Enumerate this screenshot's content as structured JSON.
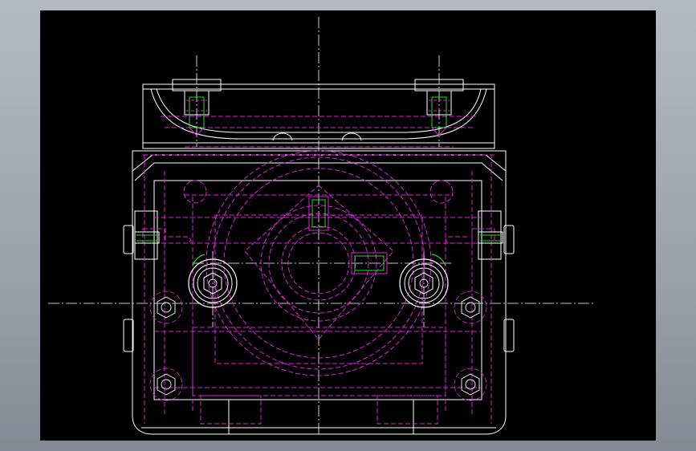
{
  "colors": {
    "window_bg": "#a9b0ba",
    "viewport_bg": "#000000",
    "outline": "#ffffff",
    "hidden_line": "#e01ee0",
    "thread": "#1ee01e",
    "centerline": "#ffffff"
  },
  "icons": {
    "socket_head_screw": "hex-socket-screw-icon",
    "hex_nut": "hex-nut-icon"
  }
}
